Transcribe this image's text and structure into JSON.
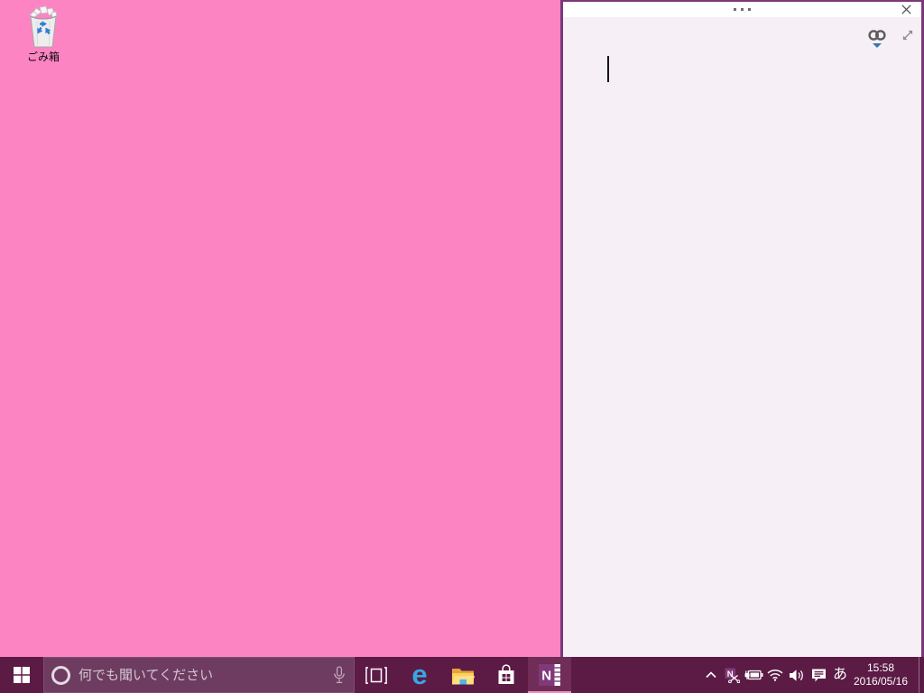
{
  "desktop": {
    "background_color": "#fd84c3",
    "recycle_bin": {
      "label": "ごみ箱"
    }
  },
  "note_window": {
    "border_color": "#7b3779",
    "titlebar_color": "#ffffff",
    "background_color": "#f7eff6",
    "content": "",
    "icons": {
      "more_options": "…",
      "close": "✕",
      "link": "chain-link with dropdown ▾",
      "expand": "⤢"
    }
  },
  "taskbar": {
    "background_color": "#5b1b45",
    "search_box_color": "#6e3c60",
    "active_app_underline_color": "#f28cc0",
    "search": {
      "placeholder": "何でも聞いてください"
    },
    "icons": {
      "edge_glyph": "e",
      "onenote_glyph": "N",
      "onenote_clipper_glyph": "N",
      "onenote_purple": "#80397b",
      "edge_blue": "#37a7e2",
      "folder_yellow": "#ffd05c"
    },
    "tray": {
      "ime_label": "あ",
      "time": "15:58",
      "date": "2016/05/16"
    }
  }
}
